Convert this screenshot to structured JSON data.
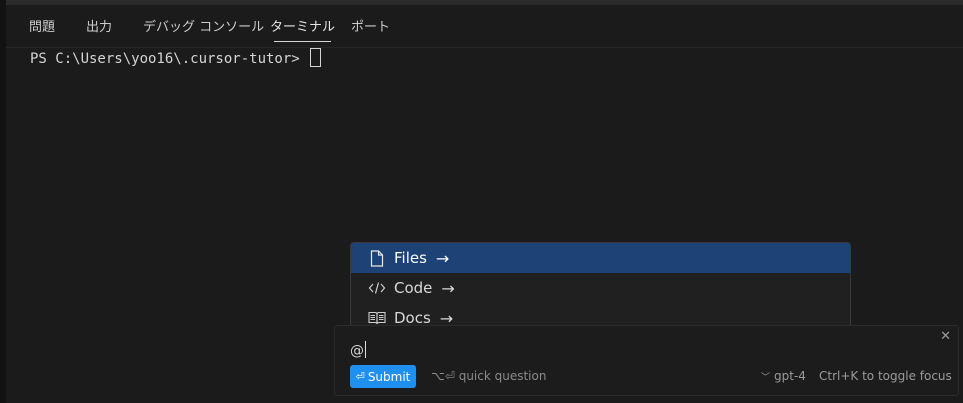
{
  "panel": {
    "tabs": [
      {
        "label": "問題"
      },
      {
        "label": "出力"
      },
      {
        "label": "デバッグ コンソール"
      },
      {
        "label": "ターミナル"
      },
      {
        "label": "ポート"
      }
    ],
    "active_tab": "ターミナル"
  },
  "terminal": {
    "prompt": "PS C:\\Users\\yoo16\\.cursor-tutor> "
  },
  "mention_menu": {
    "items": [
      {
        "label": "Files",
        "icon": "file-icon",
        "arrow": "→",
        "selected": true
      },
      {
        "label": "Code",
        "icon": "code-icon",
        "arrow": "→",
        "selected": false
      },
      {
        "label": "Docs",
        "icon": "book-icon",
        "arrow": "→",
        "selected": false
      }
    ]
  },
  "prompt_box": {
    "input_value": "@",
    "submit_label": "Submit",
    "submit_glyph": "⏎",
    "quick_question": "⌥⏎ quick question",
    "model_chevron": "﹀",
    "model": "gpt-4",
    "toggle_hint": "Ctrl+K to toggle focus",
    "close_glyph": "✕"
  },
  "colors": {
    "background": "#1b1b1b",
    "selected_item": "#1d4275",
    "submit_button": "#1f8ff0"
  }
}
